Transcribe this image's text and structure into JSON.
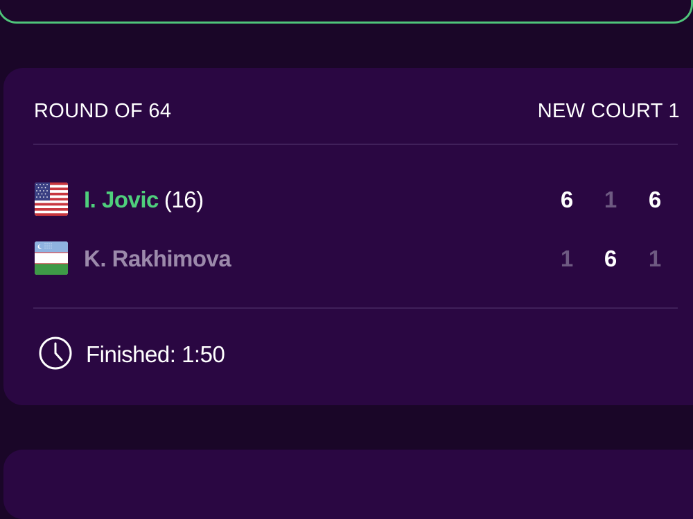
{
  "match": {
    "round": "ROUND OF 64",
    "court": "NEW COURT 1",
    "players": [
      {
        "name": "I. Jovic",
        "seed": "(16)",
        "flag": "usa-flag-icon",
        "winner": true,
        "sets": [
          "6",
          "1",
          "6"
        ],
        "set_won": [
          true,
          false,
          true
        ]
      },
      {
        "name": "K. Rakhimova",
        "seed": "",
        "flag": "uzbekistan-flag-icon",
        "winner": false,
        "sets": [
          "1",
          "6",
          "1"
        ],
        "set_won": [
          false,
          true,
          false
        ]
      }
    ],
    "status": "Finished: 1:50",
    "status_icon": "clock-icon"
  },
  "colors": {
    "background": "#1a0628",
    "card": "#2a0742",
    "winner_name": "#4fcf7c",
    "loser_name": "#9c8aab",
    "highlight_border": "#4fc47a"
  }
}
